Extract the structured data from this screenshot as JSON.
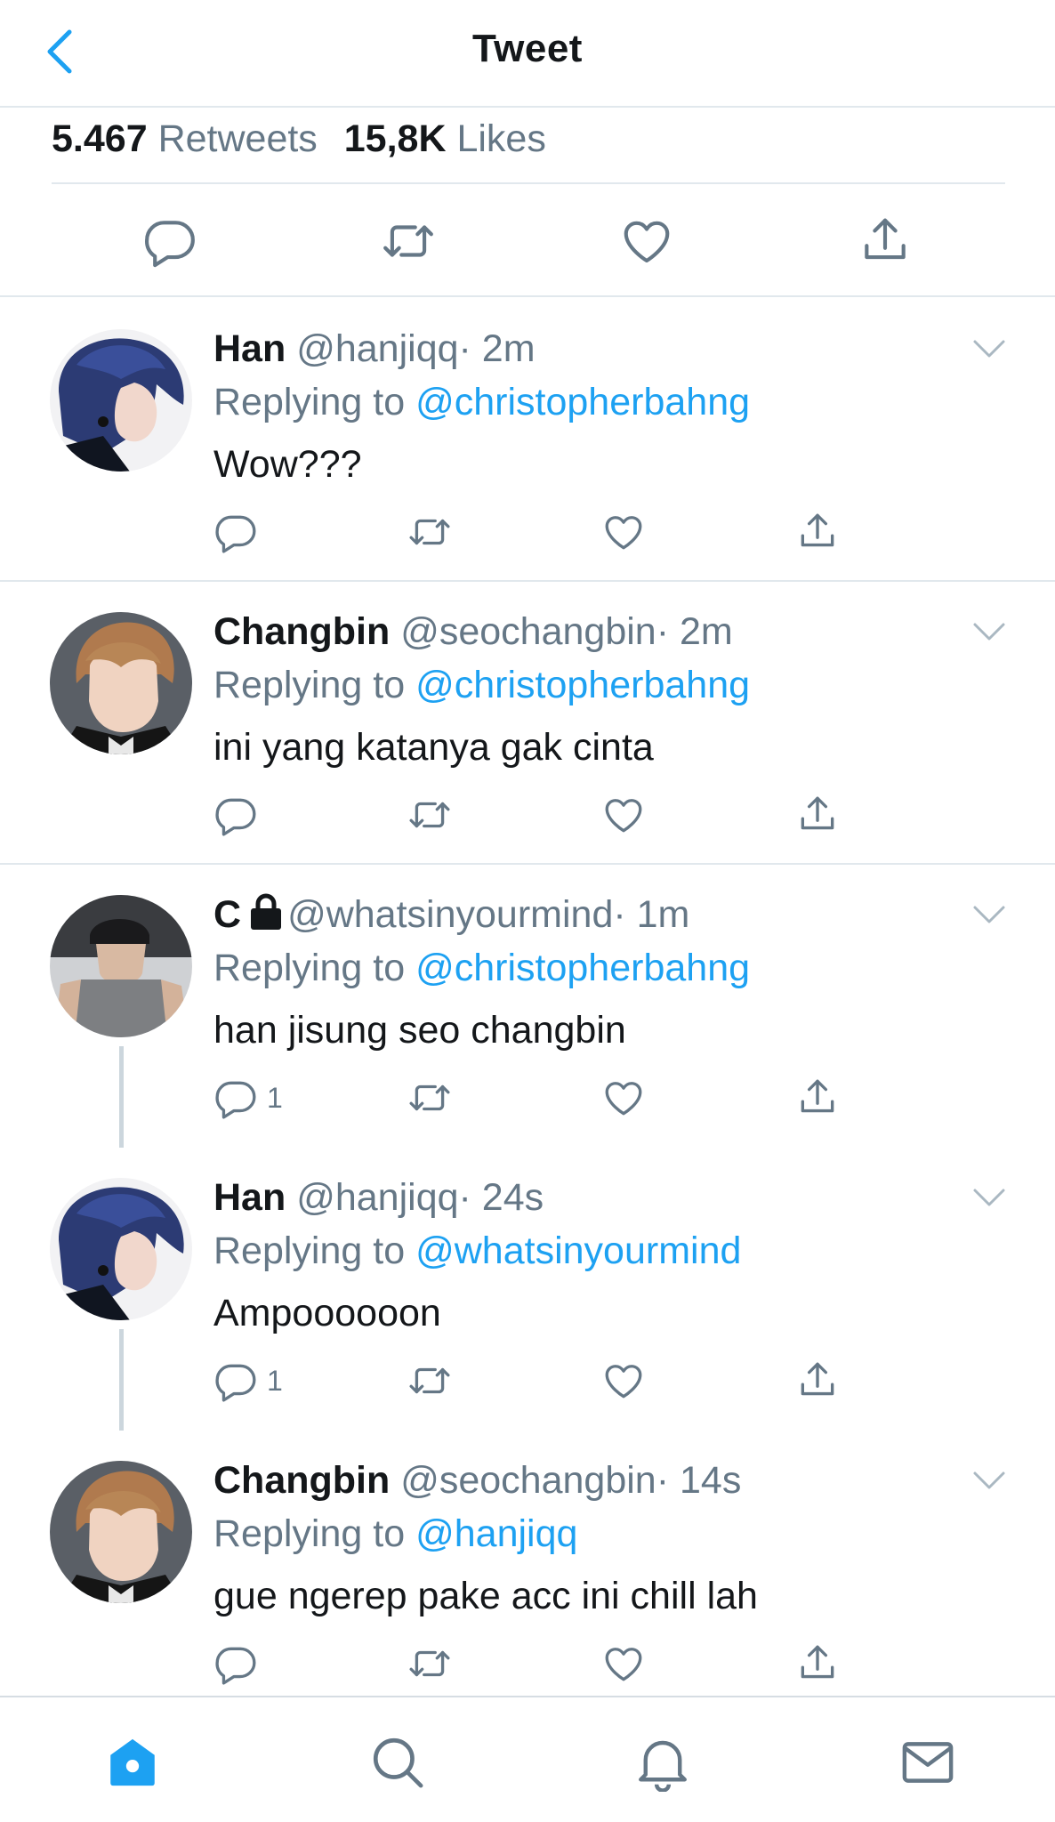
{
  "header": {
    "title": "Tweet"
  },
  "stats": {
    "retweets_count": "5.467",
    "retweets_label": "Retweets",
    "likes_count": "15,8K",
    "likes_label": "Likes"
  },
  "colors": {
    "accent": "#1da1f2",
    "muted": "#657786",
    "divider": "#e1e8ed"
  },
  "tweets": [
    {
      "name": "Han",
      "handle": "@hanjiqq",
      "time": "· 2m",
      "reply_prefix": "Replying to",
      "reply_to": "@christopherbahng",
      "text": "Wow???",
      "reply_count": ""
    },
    {
      "name": "Changbin",
      "handle": "@seochangbin",
      "time": "· 2m",
      "reply_prefix": "Replying to",
      "reply_to": "@christopherbahng",
      "text": "ini yang katanya gak cinta",
      "reply_count": ""
    },
    {
      "name": "C",
      "handle": "@whatsinyourmind",
      "time": "· 1m",
      "reply_prefix": "Replying to",
      "reply_to": "@christopherbahng",
      "text": "han jisung seo changbin",
      "reply_count": "1"
    },
    {
      "name": "Han",
      "handle": "@hanjiqq",
      "time": "· 24s",
      "reply_prefix": "Replying to",
      "reply_to": "@whatsinyourmind",
      "text": "Ampoooooon",
      "reply_count": "1"
    },
    {
      "name": "Changbin",
      "handle": "@seochangbin",
      "time": "· 14s",
      "reply_prefix": "Replying to",
      "reply_to": "@hanjiqq",
      "text": "gue ngerep pake acc ini chill lah",
      "reply_count": ""
    }
  ],
  "nav": [
    "home-icon",
    "search-icon",
    "bell-icon",
    "mail-icon"
  ]
}
